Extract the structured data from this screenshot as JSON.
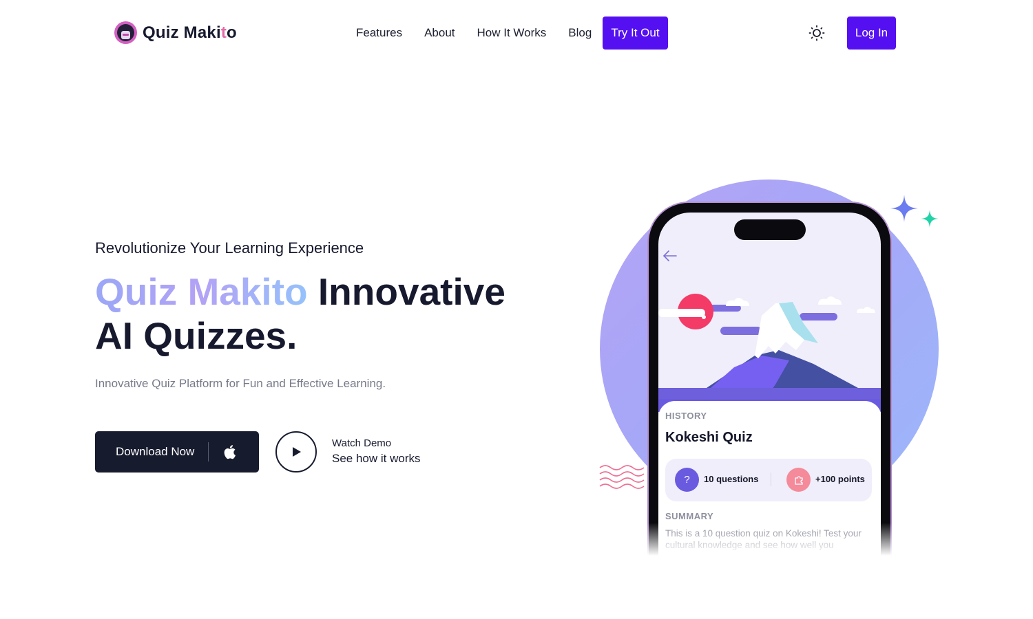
{
  "brand": {
    "name_main": "Quiz Maki",
    "name_accent": "t",
    "name_end": "o"
  },
  "nav": {
    "items": [
      {
        "label": "Features"
      },
      {
        "label": "About"
      },
      {
        "label": "How It Works"
      },
      {
        "label": "Blog"
      }
    ],
    "cta_label": "Try It Out",
    "theme_toggle_icon": "sun-icon",
    "login_label": "Log In"
  },
  "hero": {
    "eyebrow": "Revolutionize Your Learning Experience",
    "headline_gradient": "Quiz Makito",
    "headline_rest": " Innovative AI Quizzes.",
    "subtitle": "Innovative Quiz Platform for Fun and Effective Learning.",
    "download_label": "Download Now",
    "download_icon": "apple-icon",
    "demo_title": "Watch Demo",
    "demo_subtitle": "See how it works"
  },
  "phone": {
    "category": "HISTORY",
    "quiz_title": "Kokeshi Quiz",
    "questions": "10 questions",
    "points": "+100 points",
    "summary_label": "SUMMARY",
    "summary_text": "This is a 10 question quiz on Kokeshi! Test your cultural knowledge and see how well you"
  },
  "colors": {
    "primary": "#5510f2",
    "dark": "#171b2e",
    "brand_accent": "#e46aa8",
    "questions_icon": "#6a5ae0",
    "points_icon": "#f48a9a"
  }
}
